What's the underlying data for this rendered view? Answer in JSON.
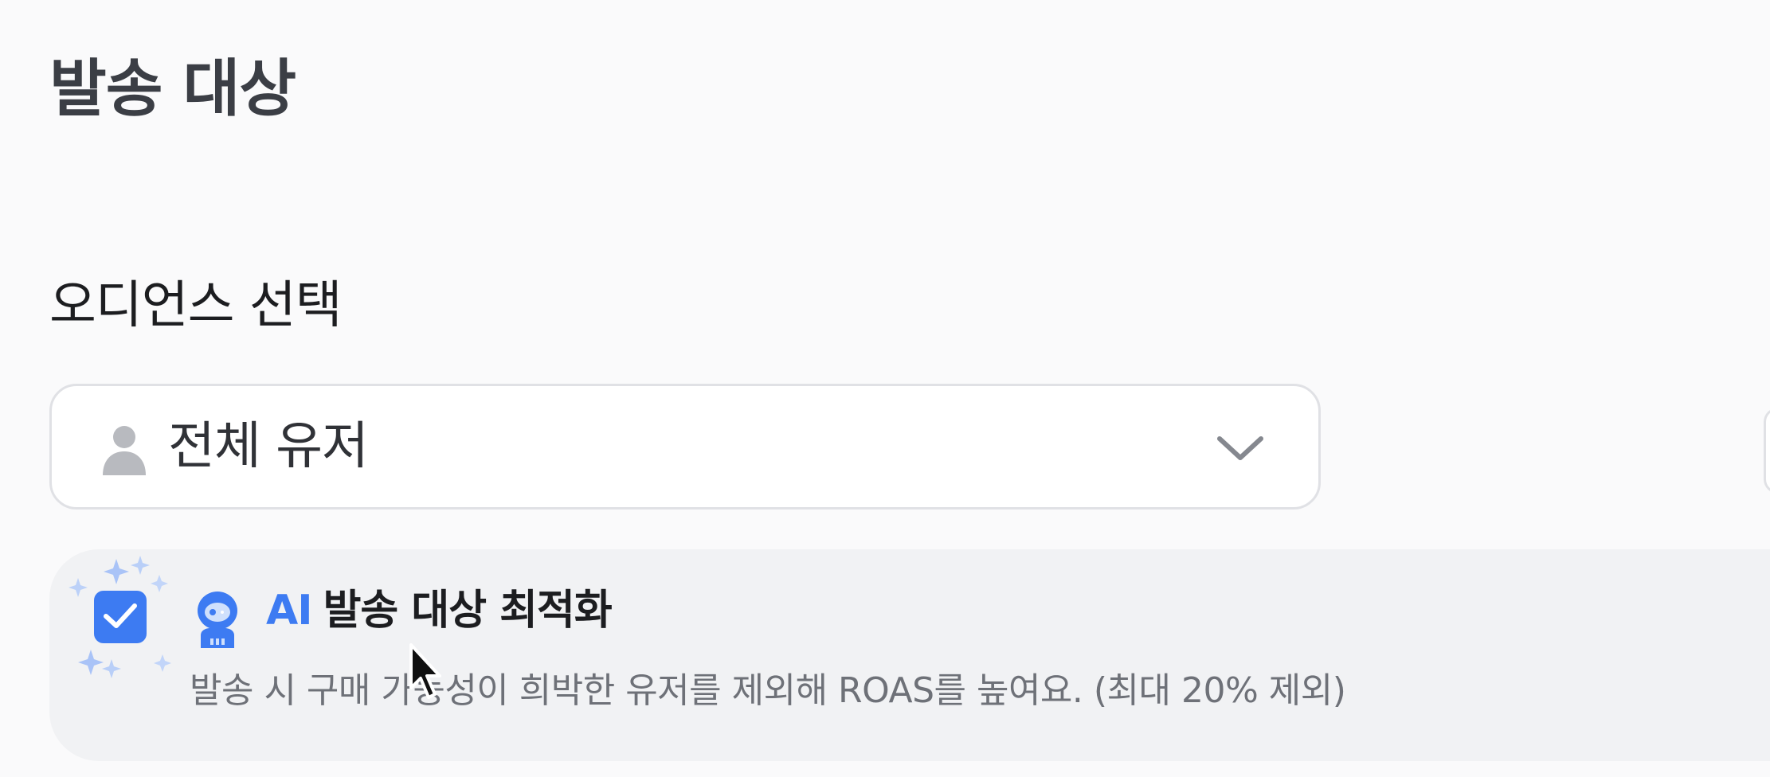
{
  "section": {
    "title": "발송 대상"
  },
  "audience": {
    "label": "오디언스 선택",
    "selected_value": "전체 유저",
    "icon": "person-icon",
    "dropdown_icon": "chevron-down-icon"
  },
  "ai_option": {
    "checked": true,
    "ai_prefix": "AI",
    "title": "발송 대상 최적화",
    "description": "발송 시 구매 가능성이 희박한 유저를 제외해 ROAS를 높여요. (최대 20% 제외)",
    "icon": "robot-icon",
    "decoration_icon": "sparkles-icon"
  },
  "colors": {
    "accent": "#3d7bf2",
    "card_background": "#f1f2f4",
    "page_background": "#fafafb",
    "muted_text": "#6e7178"
  }
}
